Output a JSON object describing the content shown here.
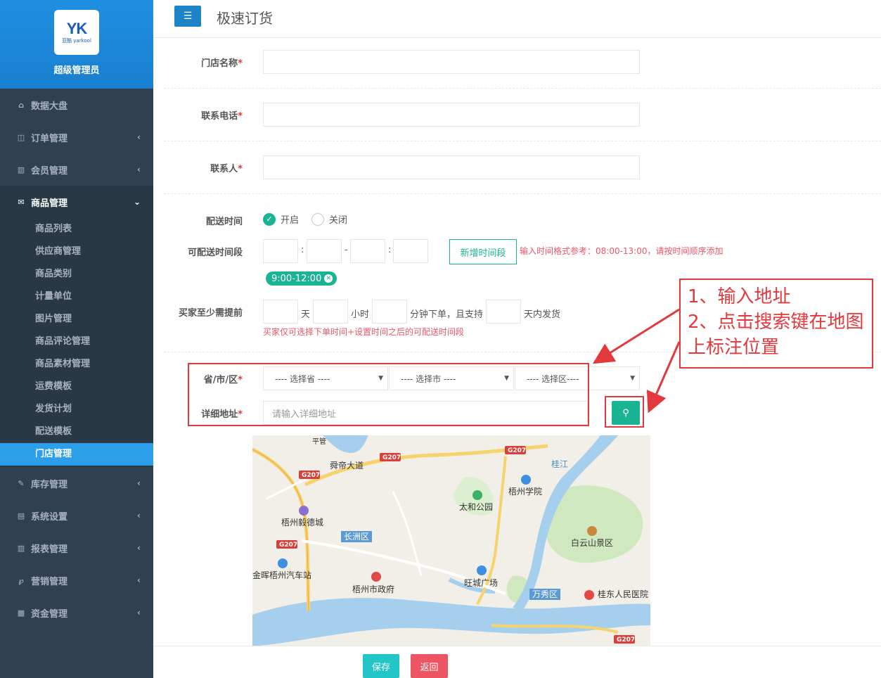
{
  "brand": {
    "logo_mark": "YK",
    "logo_sub": "亚酷 yarkool",
    "role": "超级管理员"
  },
  "sidebar": {
    "items": [
      {
        "label": "数据大盘",
        "icon": "home-icon",
        "has_arrow": false
      },
      {
        "label": "订单管理",
        "icon": "columns-icon",
        "has_arrow": true
      },
      {
        "label": "会员管理",
        "icon": "bar-chart-icon",
        "has_arrow": true
      },
      {
        "label": "商品管理",
        "icon": "envelope-icon",
        "has_arrow": true,
        "expanded": true
      },
      {
        "label": "库存管理",
        "icon": "edit-icon",
        "has_arrow": true
      },
      {
        "label": "系统设置",
        "icon": "desktop-icon",
        "has_arrow": true
      },
      {
        "label": "报表管理",
        "icon": "bar-chart-icon",
        "has_arrow": true
      },
      {
        "label": "营销管理",
        "icon": "cutlery-icon",
        "has_arrow": true
      },
      {
        "label": "资金管理",
        "icon": "money-icon",
        "has_arrow": true
      }
    ],
    "submenu": [
      "商品列表",
      "供应商管理",
      "商品类别",
      "计量单位",
      "图片管理",
      "商品评论管理",
      "商品素材管理",
      "运费模板",
      "发货计划",
      "配送模板",
      "门店管理"
    ],
    "current_submenu": "门店管理"
  },
  "header": {
    "title": "极速订货"
  },
  "form": {
    "store_name_label": "门店名称",
    "phone_label": "联系电话",
    "contact_label": "联系人",
    "required_mark": "*",
    "delivery_time_label": "配送时间",
    "delivery_on": "开启",
    "delivery_off": "关闭",
    "delivery_enabled": true,
    "time_slot_label": "可配送时间段",
    "time_colon": ":",
    "time_dash": "-",
    "add_slot_button": "新增时间段",
    "slot_hint": "输入时间格式参考：08:00-13:00，请按时间顺序添加",
    "slot_tag": "9:00-12:00",
    "advance_label": "买家至少需提前",
    "unit_day": "天",
    "unit_hour": "小时",
    "unit_minute": "分钟下单，且支持",
    "unit_ship": "天内发货",
    "advance_hint": "买家仅可选择下单时间+设置时间之后的可配送时间段",
    "region_label": "省/市/区",
    "province_select": "---- 选择省 ----",
    "city_select": "---- 选择市 ----",
    "district_select": "---- 选择区----",
    "address_label": "详细地址",
    "address_placeholder": "请输入详细地址"
  },
  "annotation": {
    "line1": "1、输入地址",
    "line2": "2、点击搜索键在地图",
    "line3": "上标注位置"
  },
  "map": {
    "labels": [
      "舜帝大道",
      "梧州学院",
      "太和公园",
      "梧州毅德城",
      "白云山景区",
      "长洲区",
      "金晖梧州汽车站",
      "梧州市政府",
      "旺城广场",
      "万秀区",
      "桂东人民医院",
      "桂江",
      "平管"
    ],
    "road_badges": [
      "G207",
      "G207",
      "G207",
      "G207",
      "G207"
    ]
  },
  "footer": {
    "save_label": "保存",
    "back_label": "返回"
  },
  "colors": {
    "primary": "#1c84c6",
    "green": "#1ab394",
    "red": "#e4393c",
    "sidebar": "#2f4050",
    "active_submenu": "#2ba0e8"
  }
}
